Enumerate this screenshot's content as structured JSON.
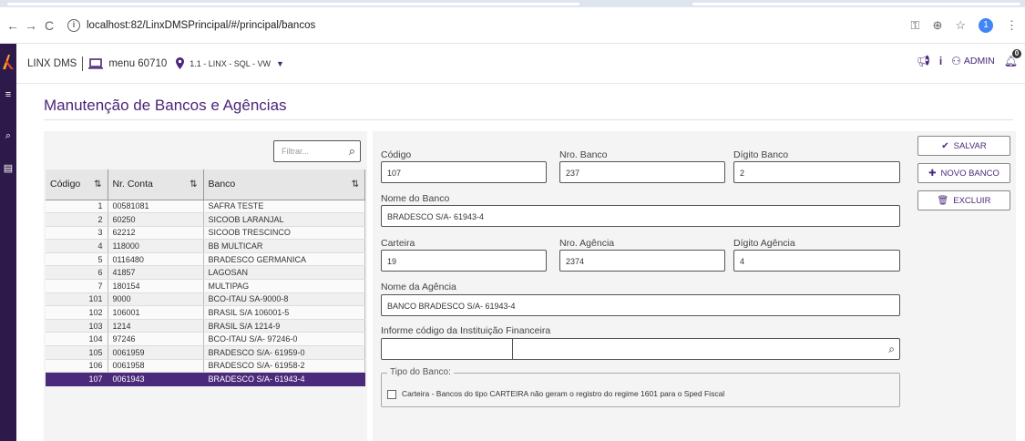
{
  "browser": {
    "url": "localhost:82/LinxDMSPrincipal/#/principal/bancos",
    "back_icon": "←",
    "forward_icon": "→",
    "reload_icon": "C",
    "avatar_letter": "1"
  },
  "header": {
    "app_name": "LINX DMS",
    "menu": "menu 60710",
    "location": "1.1 - LINX - SQL - VW",
    "user": "ADMIN",
    "notification_count": "0"
  },
  "page": {
    "title": "Manutenção de Bancos e Agências"
  },
  "list": {
    "filter_placeholder": "Filtrar...",
    "columns": [
      "Código",
      "Nr. Conta",
      "Banco"
    ],
    "rows": [
      {
        "codigo": "1",
        "conta": "00581081",
        "banco": "SAFRA TESTE"
      },
      {
        "codigo": "2",
        "conta": "60250",
        "banco": "SICOOB LARANJAL"
      },
      {
        "codigo": "3",
        "conta": "62212",
        "banco": "SICOOB TRESCINCO"
      },
      {
        "codigo": "4",
        "conta": "118000",
        "banco": "BB MULTICAR"
      },
      {
        "codigo": "5",
        "conta": "0116480",
        "banco": "BRADESCO GERMANICA"
      },
      {
        "codigo": "6",
        "conta": "41857",
        "banco": "LAGOSAN"
      },
      {
        "codigo": "7",
        "conta": "180154",
        "banco": "MULTIPAG"
      },
      {
        "codigo": "101",
        "conta": "9000",
        "banco": "BCO-ITAU SA-9000-8"
      },
      {
        "codigo": "102",
        "conta": "106001",
        "banco": "BRASIL S/A 106001-5"
      },
      {
        "codigo": "103",
        "conta": "1214",
        "banco": "BRASIL S/A 1214-9"
      },
      {
        "codigo": "104",
        "conta": "97246",
        "banco": "BCO-ITAU S/A- 97246-0"
      },
      {
        "codigo": "105",
        "conta": "0061959",
        "banco": "BRADESCO S/A- 61959-0"
      },
      {
        "codigo": "106",
        "conta": "0061958",
        "banco": "BRADESCO S/A- 61958-2"
      },
      {
        "codigo": "107",
        "conta": "0061943",
        "banco": "BRADESCO S/A- 61943-4"
      }
    ]
  },
  "form": {
    "codigo_label": "Código",
    "codigo": "107",
    "nro_banco_label": "Nro. Banco",
    "nro_banco": "237",
    "digito_banco_label": "Dígito Banco",
    "digito_banco": "2",
    "nome_banco_label": "Nome do Banco",
    "nome_banco": "BRADESCO S/A- 61943-4",
    "carteira_label": "Carteira",
    "carteira": "19",
    "nro_agencia_label": "Nro. Agência",
    "nro_agencia": "2374",
    "digito_agencia_label": "Dígito Agência",
    "digito_agencia": "4",
    "nome_agencia_label": "Nome da Agência",
    "nome_agencia": "BANCO BRADESCO S/A- 61943-4",
    "instituicao_label": "Informe código da Instituição Financeira",
    "tipo_legend": "Tipo do Banco:",
    "carteira_checkbox": "Carteira - Bancos do tipo CARTEIRA não geram o registro do regime 1601 para o Sped Fiscal"
  },
  "actions": {
    "salvar": "SALVAR",
    "novo": "NOVO BANCO",
    "excluir": "EXCLUIR"
  }
}
